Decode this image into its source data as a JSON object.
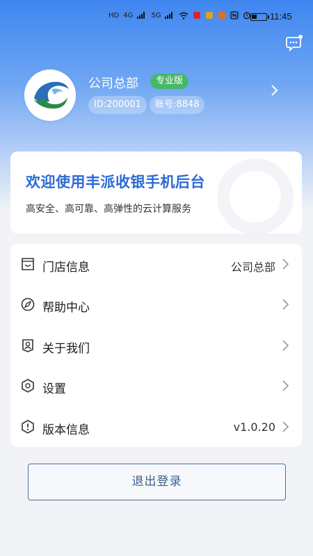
{
  "status_bar": {
    "network_labels": [
      "HD",
      "HD",
      "4G",
      "5G"
    ],
    "time": "11:45"
  },
  "header": {
    "message_icon": "chat-bubble-icon"
  },
  "profile": {
    "company_name": "公司总部",
    "edition_badge": "专业版",
    "id_label": "ID:200001",
    "account_label": "账号:8848",
    "badge_color": "#46b86a"
  },
  "welcome": {
    "title": "欢迎使用丰派收银手机后台",
    "subtitle": "高安全、高可靠、高弹性的云计算服务",
    "title_color": "#2c6ad6"
  },
  "menu": {
    "items": [
      {
        "label": "门店信息",
        "value": "公司总部",
        "icon": "store-icon"
      },
      {
        "label": "帮助中心",
        "value": "",
        "icon": "compass-icon"
      },
      {
        "label": "关于我们",
        "value": "",
        "icon": "person-badge-icon"
      },
      {
        "label": "设置",
        "value": "",
        "icon": "settings-icon"
      },
      {
        "label": "版本信息",
        "value": "v1.0.20",
        "icon": "info-icon"
      }
    ]
  },
  "logout": {
    "label": "退出登录"
  }
}
